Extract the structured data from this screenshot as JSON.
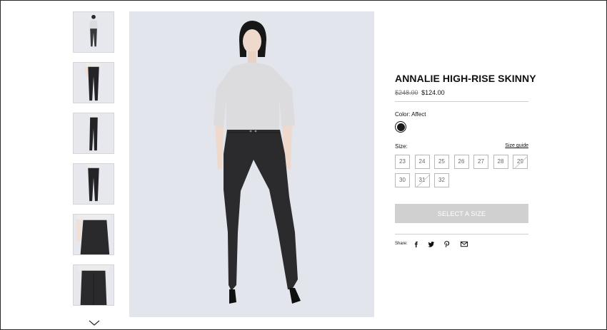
{
  "product": {
    "title": "ANNALIE HIGH-RISE SKINNY",
    "old_price": "$248.00",
    "price": "$124.00",
    "color_label": "Color: Affect",
    "swatch_color": "#1a1a1a",
    "size_label": "Size:",
    "size_guide_label": "Size guide",
    "sizes": [
      {
        "label": "23",
        "available": true
      },
      {
        "label": "24",
        "available": true
      },
      {
        "label": "25",
        "available": true
      },
      {
        "label": "26",
        "available": true
      },
      {
        "label": "27",
        "available": true
      },
      {
        "label": "28",
        "available": true
      },
      {
        "label": "29",
        "available": false
      },
      {
        "label": "30",
        "available": true
      },
      {
        "label": "31",
        "available": false
      },
      {
        "label": "32",
        "available": true
      }
    ],
    "cta_label": "SELECT A SIZE",
    "share_label": "Share:"
  },
  "share_icons": [
    "facebook-icon",
    "twitter-icon",
    "pinterest-icon",
    "mail-icon"
  ],
  "thumbnails": [
    {
      "view": "front-full"
    },
    {
      "view": "front-legs"
    },
    {
      "view": "side-legs"
    },
    {
      "view": "back-legs"
    },
    {
      "view": "front-waist-detail"
    },
    {
      "view": "back-waist-detail"
    }
  ],
  "colors": {
    "cta_disabled": "#d0d0d0",
    "image_background": "#e3e5ec",
    "denim": "#2b2b2e"
  }
}
